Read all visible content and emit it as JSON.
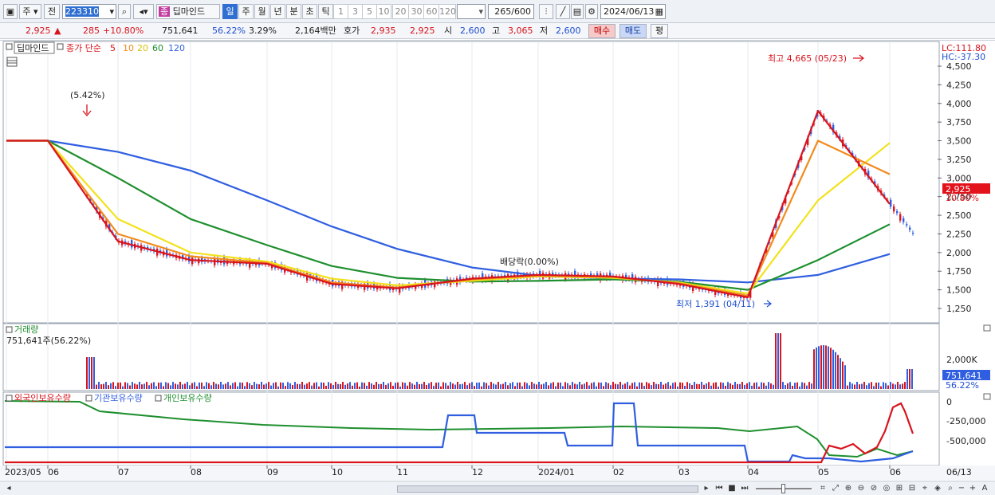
{
  "toolbar": {
    "market": "주",
    "period_prefix": "전",
    "code": "223310",
    "name": "딥마인드",
    "name_badge": "종",
    "periods": [
      "일",
      "주",
      "월",
      "년",
      "분",
      "초",
      "틱"
    ],
    "active_period": "일",
    "intervals": [
      "1",
      "3",
      "5",
      "10",
      "20",
      "30",
      "60",
      "120"
    ],
    "count": "265",
    "count_total": "/600",
    "date": "2024/06/13"
  },
  "quote": {
    "price": "2,925",
    "change_arrow": "▲",
    "change": "285",
    "change_pct": "+10.80%",
    "volume": "751,641",
    "volume_ratio": "56.22%",
    "turnover": "3.29%",
    "amount": "2,164백만",
    "bid_label": "호가",
    "ask": "2,935",
    "bid": "2,925",
    "open_label": "시",
    "open": "2,600",
    "high_label": "고",
    "high": "3,065",
    "low_label": "저",
    "low": "2,600",
    "buy_button": "매수",
    "sell_button": "매도",
    "eval_button": "평"
  },
  "price_panel": {
    "legend_name": "딥마인드",
    "ma_label": "종가 단순",
    "ma_periods": [
      "5",
      "10",
      "20",
      "60",
      "120"
    ],
    "ma_colors": [
      "#d8141d",
      "#f28a1c",
      "#f2e21c",
      "#1e8f2e",
      "#2f5fe0"
    ],
    "lc_label": "LC:111.80",
    "hc_label": "HC:-37.30",
    "last_price_tag": "2,925",
    "last_pct_tag": "10.80%",
    "annotation_high": "최고 4,665 (05/23)",
    "annotation_low": "최저 1,391 (04/11)",
    "annotation_dividend": "배당락(0.00%)",
    "annotation_jump": "(5.42%)",
    "y_ticks": [
      "4,500",
      "4,250",
      "4,000",
      "3,750",
      "3,500",
      "3,250",
      "3,000",
      "2,750",
      "2,500",
      "2,250",
      "2,000",
      "1,750",
      "1,500",
      "1,250"
    ]
  },
  "volume_panel": {
    "title": "거래량",
    "value_text": "751,641주(56.22%)",
    "y_tick": "2,000K",
    "tag_value": "751,641",
    "tag_pct": "56.22%"
  },
  "holdings_panel": {
    "legend": [
      "외국인보유수량",
      "기관보유수량",
      "개인보유수량"
    ],
    "legend_colors": [
      "#d8141d",
      "#2f5fe0",
      "#1e8f2e"
    ],
    "y_ticks": [
      "0",
      "-250,000",
      "-500,000"
    ]
  },
  "x_axis": {
    "labels": [
      "2023/05",
      "06",
      "07",
      "08",
      "09",
      "10",
      "11",
      "12",
      "2024/01",
      "02",
      "03",
      "04",
      "05",
      "06"
    ],
    "right_label": "06/13"
  },
  "chart_data": {
    "type": "line",
    "title": "딥마인드",
    "x": [
      "2023/05",
      "06",
      "07",
      "08",
      "09",
      "10",
      "11",
      "12",
      "2024/01",
      "02",
      "03",
      "04",
      "05",
      "06"
    ],
    "ylim": [
      1250,
      4700
    ],
    "series": [
      {
        "name": "5",
        "values": [
          3500,
          3500,
          2150,
          1900,
          1850,
          1580,
          1520,
          1650,
          1700,
          1680,
          1580,
          1400,
          3900,
          2650
        ]
      },
      {
        "name": "10",
        "values": [
          3500,
          3500,
          2250,
          1950,
          1860,
          1600,
          1530,
          1640,
          1690,
          1670,
          1590,
          1420,
          3500,
          3050
        ]
      },
      {
        "name": "20",
        "values": [
          3500,
          3500,
          2450,
          2000,
          1880,
          1650,
          1560,
          1620,
          1680,
          1660,
          1600,
          1450,
          2700,
          3470
        ]
      },
      {
        "name": "60",
        "values": [
          3500,
          3500,
          3000,
          2450,
          2100,
          1820,
          1660,
          1610,
          1620,
          1640,
          1610,
          1500,
          1900,
          2380
        ]
      },
      {
        "name": "120",
        "values": [
          3500,
          3500,
          3350,
          3100,
          2700,
          2350,
          2050,
          1800,
          1690,
          1650,
          1640,
          1600,
          1700,
          1980
        ]
      }
    ]
  }
}
